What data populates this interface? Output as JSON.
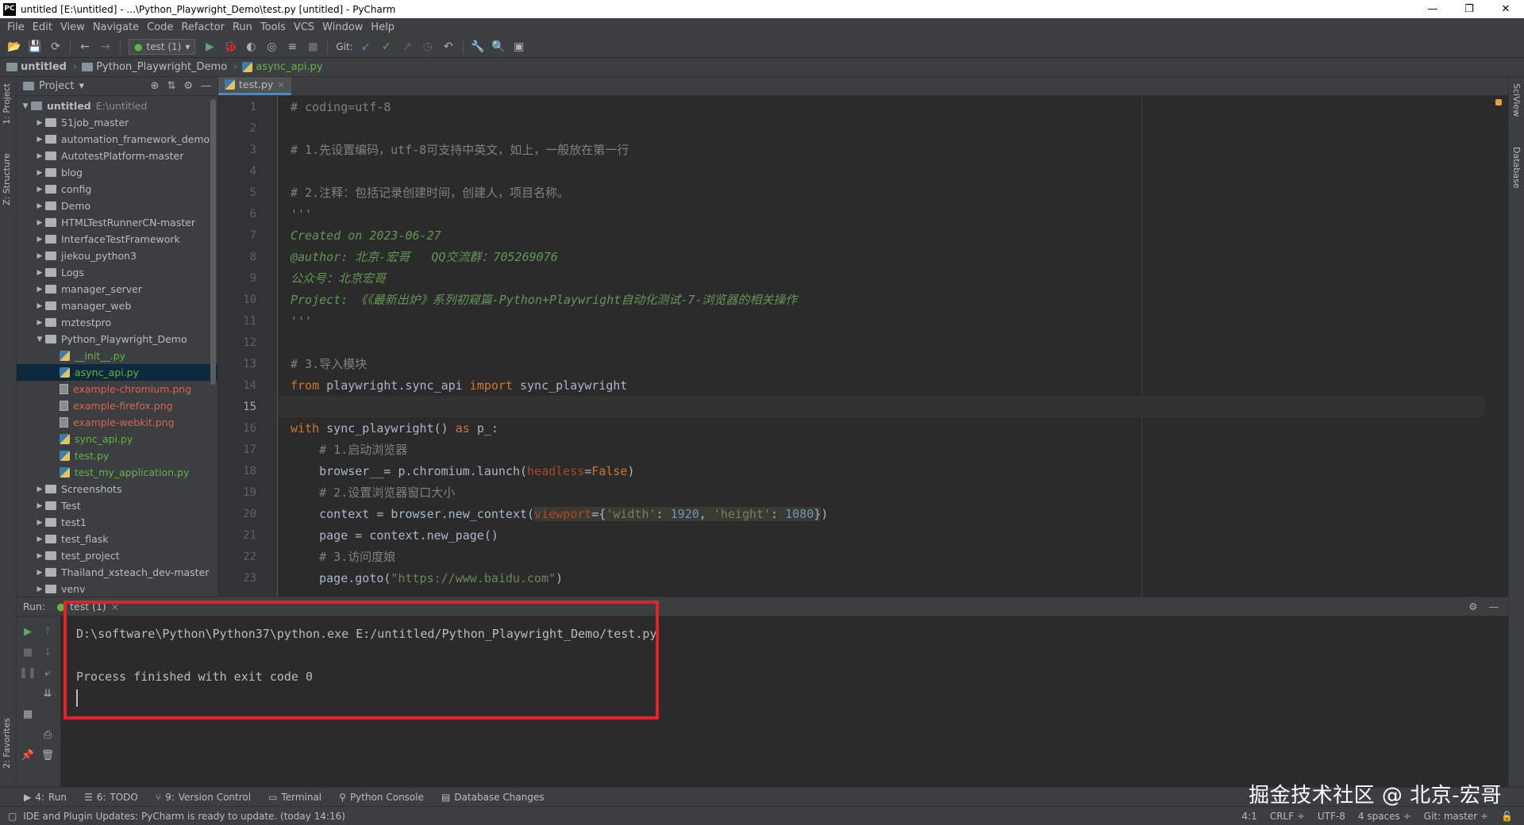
{
  "window": {
    "title": "untitled [E:\\untitled] - ...\\Python_Playwright_Demo\\test.py [untitled] - PyCharm",
    "app_icon_text": "PC",
    "controls": [
      "—",
      "❐",
      "✕"
    ]
  },
  "menu": [
    "File",
    "Edit",
    "View",
    "Navigate",
    "Code",
    "Refactor",
    "Run",
    "Tools",
    "VCS",
    "Window",
    "Help"
  ],
  "toolbar": {
    "run_config": "test (1)",
    "git_label": "Git:"
  },
  "breadcrumb": {
    "project": "untitled",
    "folder": "Python_Playwright_Demo",
    "file": "async_api.py"
  },
  "left_stripe": {
    "project_tab": "1: Project",
    "structure_tab": "Z: Structure",
    "favorites_tab": "2: Favorites"
  },
  "right_stripe": {
    "sciview_tab": "SciView",
    "database_tab": "Database"
  },
  "project_panel": {
    "title": "Project",
    "root_name": "untitled",
    "root_path": "E:\\untitled",
    "items": [
      {
        "name": "51job_master",
        "type": "folder",
        "depth": 1,
        "expanded": false
      },
      {
        "name": "automation_framework_demo",
        "type": "folder",
        "depth": 1,
        "expanded": false
      },
      {
        "name": "AutotestPlatform-master",
        "type": "folder",
        "depth": 1,
        "expanded": false
      },
      {
        "name": "blog",
        "type": "folder",
        "depth": 1,
        "expanded": false
      },
      {
        "name": "config",
        "type": "folder",
        "depth": 1,
        "expanded": false
      },
      {
        "name": "Demo",
        "type": "folder",
        "depth": 1,
        "expanded": false
      },
      {
        "name": "HTMLTestRunnerCN-master",
        "type": "folder",
        "depth": 1,
        "expanded": false
      },
      {
        "name": "InterfaceTestFramework",
        "type": "folder",
        "depth": 1,
        "expanded": false
      },
      {
        "name": "jiekou_python3",
        "type": "folder",
        "depth": 1,
        "expanded": false
      },
      {
        "name": "Logs",
        "type": "folder",
        "depth": 1,
        "expanded": false
      },
      {
        "name": "manager_server",
        "type": "folder",
        "depth": 1,
        "expanded": false
      },
      {
        "name": "manager_web",
        "type": "folder",
        "depth": 1,
        "expanded": false
      },
      {
        "name": "mztestpro",
        "type": "folder",
        "depth": 1,
        "expanded": false
      },
      {
        "name": "Python_Playwright_Demo",
        "type": "folder",
        "depth": 1,
        "expanded": true
      },
      {
        "name": "__init__.py",
        "type": "py",
        "depth": 2,
        "color": "green"
      },
      {
        "name": "async_api.py",
        "type": "py",
        "depth": 2,
        "color": "green",
        "selected": true
      },
      {
        "name": "example-chromium.png",
        "type": "img",
        "depth": 2,
        "color": "red"
      },
      {
        "name": "example-firefox.png",
        "type": "img",
        "depth": 2,
        "color": "red"
      },
      {
        "name": "example-webkit.png",
        "type": "img",
        "depth": 2,
        "color": "red"
      },
      {
        "name": "sync_api.py",
        "type": "py",
        "depth": 2,
        "color": "green"
      },
      {
        "name": "test.py",
        "type": "py",
        "depth": 2,
        "color": "green"
      },
      {
        "name": "test_my_application.py",
        "type": "py",
        "depth": 2,
        "color": "green"
      },
      {
        "name": "Screenshots",
        "type": "folder",
        "depth": 1,
        "expanded": false
      },
      {
        "name": "Test",
        "type": "folder",
        "depth": 1,
        "expanded": false
      },
      {
        "name": "test1",
        "type": "folder",
        "depth": 1,
        "expanded": false
      },
      {
        "name": "test_flask",
        "type": "folder",
        "depth": 1,
        "expanded": false
      },
      {
        "name": "test_project",
        "type": "folder",
        "depth": 1,
        "expanded": false
      },
      {
        "name": "Thailand_xsteach_dev-master",
        "type": "folder",
        "depth": 1,
        "expanded": false
      },
      {
        "name": "venv",
        "type": "folder",
        "depth": 1,
        "expanded": false
      }
    ]
  },
  "editor": {
    "tab": "test.py",
    "lines": [
      {
        "n": "1",
        "tokens": [
          {
            "c": "cm",
            "t": "# coding=utf-8"
          }
        ]
      },
      {
        "n": "2",
        "tokens": []
      },
      {
        "n": "3",
        "tokens": [
          {
            "c": "cm",
            "t": "# 1.先设置编码，utf-8可支持中英文，如上，一般放在第一行"
          }
        ]
      },
      {
        "n": "4",
        "tokens": []
      },
      {
        "n": "5",
        "tokens": [
          {
            "c": "cm",
            "t": "# 2.注释：包括记录创建时间，创建人，项目名称。"
          }
        ]
      },
      {
        "n": "6",
        "tokens": [
          {
            "c": "doc",
            "t": "'''"
          }
        ]
      },
      {
        "n": "7",
        "tokens": [
          {
            "c": "doc",
            "t": "Created on 2023-06-27"
          }
        ]
      },
      {
        "n": "8",
        "tokens": [
          {
            "c": "doc",
            "t": "@author: 北京-宏哥   QQ交流群：705269076"
          }
        ]
      },
      {
        "n": "9",
        "tokens": [
          {
            "c": "doc",
            "t": "公众号：北京宏哥"
          }
        ]
      },
      {
        "n": "10",
        "tokens": [
          {
            "c": "doc",
            "t": "Project: 《《最新出炉》系列初窥篇-Python+Playwright自动化测试-7-浏览器的相关操作"
          }
        ]
      },
      {
        "n": "11",
        "tokens": [
          {
            "c": "doc",
            "t": "'''"
          }
        ]
      },
      {
        "n": "12",
        "tokens": []
      },
      {
        "n": "13",
        "tokens": [
          {
            "c": "cm",
            "t": "# 3.导入模块"
          }
        ]
      },
      {
        "n": "14",
        "tokens": [
          {
            "c": "kw",
            "t": "from "
          },
          {
            "c": "tx",
            "t": "playwright.sync_api "
          },
          {
            "c": "kw",
            "t": "import "
          },
          {
            "c": "tx",
            "t": "sync_playwright"
          }
        ]
      },
      {
        "n": "15",
        "tokens": [],
        "current": true
      },
      {
        "n": "16",
        "tokens": [
          {
            "c": "kw",
            "t": "with "
          },
          {
            "c": "tx",
            "t": "sync_playwright() "
          },
          {
            "c": "kw",
            "t": "as "
          },
          {
            "c": "tx",
            "t": "p_:"
          }
        ]
      },
      {
        "n": "17",
        "tokens": [
          {
            "c": "tx",
            "t": "    "
          },
          {
            "c": "cm",
            "t": "# 1.启动浏览器"
          }
        ]
      },
      {
        "n": "18",
        "tokens": [
          {
            "c": "tx",
            "t": "    browser__= p.chromium.launch("
          },
          {
            "c": "param",
            "t": "headless"
          },
          {
            "c": "tx",
            "t": "="
          },
          {
            "c": "kw",
            "t": "False"
          },
          {
            "c": "tx",
            "t": ")"
          }
        ]
      },
      {
        "n": "19",
        "tokens": [
          {
            "c": "tx",
            "t": "    "
          },
          {
            "c": "cm",
            "t": "# 2.设置浏览器窗口大小"
          }
        ]
      },
      {
        "n": "20",
        "tokens": [
          {
            "c": "tx",
            "t": "    context = browser.new_context("
          },
          {
            "c": "param hl",
            "t": "viewport"
          },
          {
            "c": "tx hl",
            "t": "={"
          },
          {
            "c": "str hl",
            "t": "'width'"
          },
          {
            "c": "tx hl",
            "t": ": "
          },
          {
            "c": "num hl",
            "t": "1920"
          },
          {
            "c": "tx hl",
            "t": ", "
          },
          {
            "c": "str hl",
            "t": "'height'"
          },
          {
            "c": "tx hl",
            "t": ": "
          },
          {
            "c": "num hl",
            "t": "1080"
          },
          {
            "c": "tx hl",
            "t": "}"
          },
          {
            "c": "tx",
            "t": ")"
          }
        ]
      },
      {
        "n": "21",
        "tokens": [
          {
            "c": "tx",
            "t": "    page = context.new_page()"
          }
        ]
      },
      {
        "n": "22",
        "tokens": [
          {
            "c": "tx",
            "t": "    "
          },
          {
            "c": "cm",
            "t": "# 3.访问度娘"
          }
        ]
      },
      {
        "n": "23",
        "tokens": [
          {
            "c": "tx",
            "t": "    page.goto("
          },
          {
            "c": "str",
            "t": "\"https://www.baidu.com\""
          },
          {
            "c": "tx",
            "t": ")"
          }
        ]
      }
    ]
  },
  "run_panel": {
    "label": "Run:",
    "tab": "test (1)",
    "output": [
      "D:\\software\\Python\\Python37\\python.exe E:/untitled/Python_Playwright_Demo/test.py",
      "",
      "Process finished with exit code 0"
    ]
  },
  "tool_windows": [
    {
      "key": "4",
      "label": "Run",
      "icon": "run-icon"
    },
    {
      "key": "6",
      "label": "TODO",
      "icon": "todo-icon"
    },
    {
      "key": "9",
      "label": "Version Control",
      "icon": "vcs-icon"
    },
    {
      "key": "",
      "label": "Terminal",
      "icon": "terminal-icon"
    },
    {
      "key": "",
      "label": "Python Console",
      "icon": "python-console-icon"
    },
    {
      "key": "",
      "label": "Database Changes",
      "icon": "database-icon"
    }
  ],
  "status": {
    "message": "IDE and Plugin Updates: PyCharm is ready to update. (today 14:16)",
    "position": "4:1",
    "line_sep": "CRLF ÷",
    "encoding": "UTF-8",
    "indent": "4 spaces ÷",
    "git_branch": "Git: master ÷"
  },
  "watermark": "掘金技术社区 @ 北京-宏哥"
}
